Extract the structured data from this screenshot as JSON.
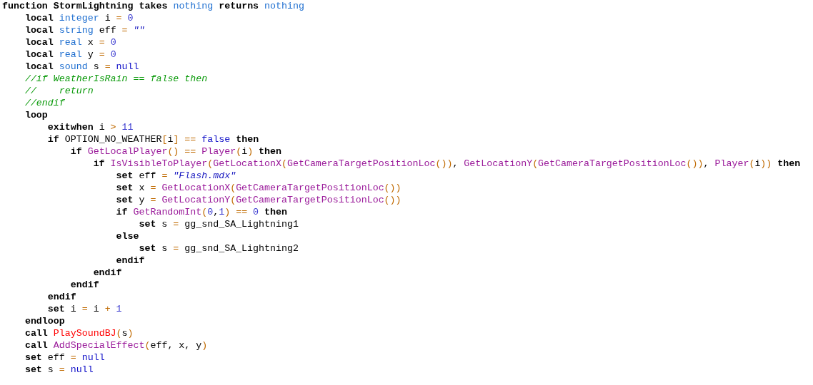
{
  "editor": {
    "lines": [
      {
        "tokens": [
          {
            "kind": "kw",
            "text": "function "
          },
          {
            "kind": "kw",
            "text": "StormLightning"
          },
          {
            "kind": "kw",
            "text": " takes "
          },
          {
            "kind": "type",
            "text": "nothing"
          },
          {
            "kind": "kw",
            "text": " returns "
          },
          {
            "kind": "type",
            "text": "nothing"
          }
        ],
        "children": [
          {
            "tokens": [
              {
                "kind": "kw",
                "text": "local "
              },
              {
                "kind": "type",
                "text": "integer"
              },
              {
                "kind": "id",
                "text": " i "
              },
              {
                "kind": "op",
                "text": "="
              },
              {
                "kind": "num",
                "text": " 0"
              }
            ]
          },
          {
            "tokens": [
              {
                "kind": "kw",
                "text": "local "
              },
              {
                "kind": "type",
                "text": "string"
              },
              {
                "kind": "id",
                "text": " eff "
              },
              {
                "kind": "op",
                "text": "="
              },
              {
                "kind": "str",
                "text": " \"\""
              }
            ]
          },
          {
            "tokens": [
              {
                "kind": "kw",
                "text": "local "
              },
              {
                "kind": "type",
                "text": "real"
              },
              {
                "kind": "id",
                "text": " x "
              },
              {
                "kind": "op",
                "text": "="
              },
              {
                "kind": "num",
                "text": " 0"
              }
            ]
          },
          {
            "tokens": [
              {
                "kind": "kw",
                "text": "local "
              },
              {
                "kind": "type",
                "text": "real"
              },
              {
                "kind": "id",
                "text": " y "
              },
              {
                "kind": "op",
                "text": "="
              },
              {
                "kind": "num",
                "text": " 0"
              }
            ]
          },
          {
            "tokens": [
              {
                "kind": "kw",
                "text": "local "
              },
              {
                "kind": "type",
                "text": "sound"
              },
              {
                "kind": "id",
                "text": " s "
              },
              {
                "kind": "op",
                "text": "="
              },
              {
                "kind": "const",
                "text": " null"
              }
            ]
          },
          {
            "tokens": [
              {
                "kind": "cmt",
                "text": "//if WeatherIsRain == false then"
              }
            ]
          },
          {
            "tokens": [
              {
                "kind": "cmt",
                "text": "//    return"
              }
            ]
          },
          {
            "tokens": [
              {
                "kind": "cmt",
                "text": "//endif"
              }
            ]
          },
          {
            "tokens": [
              {
                "kind": "kw",
                "text": "loop"
              }
            ],
            "children": [
              {
                "tokens": [
                  {
                    "kind": "kw",
                    "text": "exitwhen"
                  },
                  {
                    "kind": "id",
                    "text": " i "
                  },
                  {
                    "kind": "op",
                    "text": ">"
                  },
                  {
                    "kind": "num",
                    "text": " 11"
                  }
                ]
              },
              {
                "tokens": [
                  {
                    "kind": "kw",
                    "text": "if "
                  },
                  {
                    "kind": "id",
                    "text": "OPTION_NO_WEATHER"
                  },
                  {
                    "kind": "op",
                    "text": "["
                  },
                  {
                    "kind": "id",
                    "text": "i"
                  },
                  {
                    "kind": "op",
                    "text": "]"
                  },
                  {
                    "kind": "op",
                    "text": " =="
                  },
                  {
                    "kind": "const",
                    "text": " false"
                  },
                  {
                    "kind": "kw",
                    "text": " then"
                  }
                ],
                "children": [
                  {
                    "tokens": [
                      {
                        "kind": "kw",
                        "text": "if "
                      },
                      {
                        "kind": "fn",
                        "text": "GetLocalPlayer"
                      },
                      {
                        "kind": "op",
                        "text": "()"
                      },
                      {
                        "kind": "op",
                        "text": " == "
                      },
                      {
                        "kind": "fn",
                        "text": "Player"
                      },
                      {
                        "kind": "op",
                        "text": "("
                      },
                      {
                        "kind": "id",
                        "text": "i"
                      },
                      {
                        "kind": "op",
                        "text": ")"
                      },
                      {
                        "kind": "kw",
                        "text": " then"
                      }
                    ],
                    "children": [
                      {
                        "tokens": [
                          {
                            "kind": "kw",
                            "text": "if "
                          },
                          {
                            "kind": "fn",
                            "text": "IsVisibleToPlayer"
                          },
                          {
                            "kind": "op",
                            "text": "("
                          },
                          {
                            "kind": "fn",
                            "text": "GetLocationX"
                          },
                          {
                            "kind": "op",
                            "text": "("
                          },
                          {
                            "kind": "fn",
                            "text": "GetCameraTargetPositionLoc"
                          },
                          {
                            "kind": "op",
                            "text": "())"
                          },
                          {
                            "kind": "id",
                            "text": ", "
                          },
                          {
                            "kind": "fn",
                            "text": "GetLocationY"
                          },
                          {
                            "kind": "op",
                            "text": "("
                          },
                          {
                            "kind": "fn",
                            "text": "GetCameraTargetPositionLoc"
                          },
                          {
                            "kind": "op",
                            "text": "())"
                          },
                          {
                            "kind": "id",
                            "text": ", "
                          },
                          {
                            "kind": "fn",
                            "text": "Player"
                          },
                          {
                            "kind": "op",
                            "text": "("
                          },
                          {
                            "kind": "id",
                            "text": "i"
                          },
                          {
                            "kind": "op",
                            "text": "))"
                          },
                          {
                            "kind": "kw",
                            "text": " then"
                          }
                        ],
                        "children": [
                          {
                            "tokens": [
                              {
                                "kind": "kw",
                                "text": "set "
                              },
                              {
                                "kind": "id",
                                "text": "eff "
                              },
                              {
                                "kind": "op",
                                "text": "="
                              },
                              {
                                "kind": "str",
                                "text": " \"Flash.mdx\""
                              }
                            ]
                          },
                          {
                            "tokens": [
                              {
                                "kind": "kw",
                                "text": "set "
                              },
                              {
                                "kind": "id",
                                "text": "x "
                              },
                              {
                                "kind": "op",
                                "text": "= "
                              },
                              {
                                "kind": "fn",
                                "text": "GetLocationX"
                              },
                              {
                                "kind": "op",
                                "text": "("
                              },
                              {
                                "kind": "fn",
                                "text": "GetCameraTargetPositionLoc"
                              },
                              {
                                "kind": "op",
                                "text": "())"
                              }
                            ]
                          },
                          {
                            "tokens": [
                              {
                                "kind": "kw",
                                "text": "set "
                              },
                              {
                                "kind": "id",
                                "text": "y "
                              },
                              {
                                "kind": "op",
                                "text": "= "
                              },
                              {
                                "kind": "fn",
                                "text": "GetLocationY"
                              },
                              {
                                "kind": "op",
                                "text": "("
                              },
                              {
                                "kind": "fn",
                                "text": "GetCameraTargetPositionLoc"
                              },
                              {
                                "kind": "op",
                                "text": "())"
                              }
                            ]
                          },
                          {
                            "tokens": [
                              {
                                "kind": "kw",
                                "text": "if "
                              },
                              {
                                "kind": "fn",
                                "text": "GetRandomInt"
                              },
                              {
                                "kind": "op",
                                "text": "("
                              },
                              {
                                "kind": "num",
                                "text": "0"
                              },
                              {
                                "kind": "id",
                                "text": ","
                              },
                              {
                                "kind": "num",
                                "text": "1"
                              },
                              {
                                "kind": "op",
                                "text": ")"
                              },
                              {
                                "kind": "op",
                                "text": " =="
                              },
                              {
                                "kind": "num",
                                "text": " 0"
                              },
                              {
                                "kind": "kw",
                                "text": " then"
                              }
                            ],
                            "children": [
                              {
                                "tokens": [
                                  {
                                    "kind": "kw",
                                    "text": "set "
                                  },
                                  {
                                    "kind": "id",
                                    "text": "s "
                                  },
                                  {
                                    "kind": "op",
                                    "text": "="
                                  },
                                  {
                                    "kind": "id",
                                    "text": " gg_snd_SA_Lightning1"
                                  }
                                ]
                              }
                            ]
                          },
                          {
                            "tokens": [
                              {
                                "kind": "kw",
                                "text": "else"
                              }
                            ],
                            "children": [
                              {
                                "tokens": [
                                  {
                                    "kind": "kw",
                                    "text": "set "
                                  },
                                  {
                                    "kind": "id",
                                    "text": "s "
                                  },
                                  {
                                    "kind": "op",
                                    "text": "="
                                  },
                                  {
                                    "kind": "id",
                                    "text": " gg_snd_SA_Lightning2"
                                  }
                                ]
                              }
                            ]
                          },
                          {
                            "tokens": [
                              {
                                "kind": "kw",
                                "text": "endif"
                              }
                            ]
                          }
                        ]
                      },
                      {
                        "tokens": [
                          {
                            "kind": "kw",
                            "text": "endif"
                          }
                        ]
                      }
                    ]
                  },
                  {
                    "tokens": [
                      {
                        "kind": "kw",
                        "text": "endif"
                      }
                    ]
                  }
                ]
              },
              {
                "tokens": [
                  {
                    "kind": "kw",
                    "text": "endif"
                  }
                ]
              },
              {
                "tokens": [
                  {
                    "kind": "kw",
                    "text": "set "
                  },
                  {
                    "kind": "id",
                    "text": "i "
                  },
                  {
                    "kind": "op",
                    "text": "="
                  },
                  {
                    "kind": "id",
                    "text": " i "
                  },
                  {
                    "kind": "op",
                    "text": "+"
                  },
                  {
                    "kind": "num",
                    "text": " 1"
                  }
                ]
              }
            ]
          },
          {
            "tokens": [
              {
                "kind": "kw",
                "text": "endloop"
              }
            ]
          },
          {
            "tokens": [
              {
                "kind": "kw",
                "text": "call "
              },
              {
                "kind": "bj",
                "text": "PlaySoundBJ"
              },
              {
                "kind": "op",
                "text": "("
              },
              {
                "kind": "id",
                "text": "s"
              },
              {
                "kind": "op",
                "text": ")"
              }
            ]
          },
          {
            "tokens": [
              {
                "kind": "kw",
                "text": "call "
              },
              {
                "kind": "fn",
                "text": "AddSpecialEffect"
              },
              {
                "kind": "op",
                "text": "("
              },
              {
                "kind": "id",
                "text": "eff, x, y"
              },
              {
                "kind": "op",
                "text": ")"
              }
            ]
          },
          {
            "tokens": [
              {
                "kind": "kw",
                "text": "set "
              },
              {
                "kind": "id",
                "text": "eff "
              },
              {
                "kind": "op",
                "text": "="
              },
              {
                "kind": "const",
                "text": " null"
              }
            ]
          },
          {
            "tokens": [
              {
                "kind": "kw",
                "text": "set "
              },
              {
                "kind": "id",
                "text": "s "
              },
              {
                "kind": "op",
                "text": "="
              },
              {
                "kind": "const",
                "text": " null"
              }
            ]
          }
        ]
      }
    ]
  }
}
